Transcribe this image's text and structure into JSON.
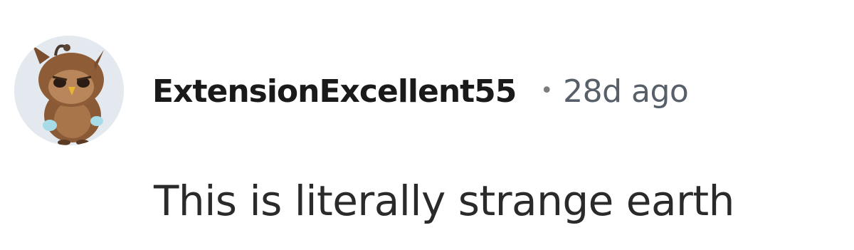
{
  "comment": {
    "avatar_icon": "owl-avatar-icon",
    "username": "ExtensionExcellent55",
    "separator": "•",
    "timestamp": "28d ago",
    "body": "This is literally strange earth"
  },
  "colors": {
    "username": "#1a1a1b",
    "timestamp": "#57606a",
    "body": "#2a2a2b",
    "avatar_bg": "#dfe6ec"
  }
}
